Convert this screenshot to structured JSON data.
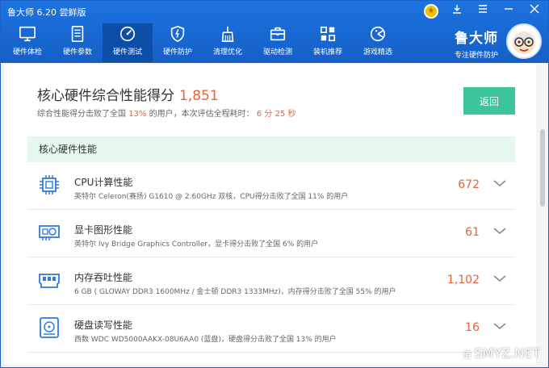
{
  "window": {
    "title": "鲁大师 6.20 尝鲜版"
  },
  "nav": [
    {
      "label": "硬件体检",
      "icon": "monitor-icon"
    },
    {
      "label": "硬件参数",
      "icon": "document-icon"
    },
    {
      "label": "硬件测试",
      "icon": "speedometer-icon"
    },
    {
      "label": "硬件防护",
      "icon": "shield-icon"
    },
    {
      "label": "清理优化",
      "icon": "broom-icon"
    },
    {
      "label": "驱动检测",
      "icon": "toolbox-icon"
    },
    {
      "label": "装机推荐",
      "icon": "apps-icon"
    },
    {
      "label": "游戏精选",
      "icon": "gamepad-icon"
    }
  ],
  "brand": {
    "name": "鲁大师",
    "subtitle": "专注硬件防护"
  },
  "score": {
    "title": "核心硬件综合性能得分",
    "value": "1,851",
    "desc_prefix": "综合性能得分击败了全国",
    "beat_percent": "13%",
    "desc_middle": "的用户，本次评估全程耗时：",
    "duration_min": "6",
    "duration_min_unit": "分",
    "duration_sec": "25",
    "duration_sec_unit": "秒"
  },
  "back_button": "返回",
  "section": {
    "title": "核心硬件性能"
  },
  "rows": [
    {
      "title": "CPU计算性能",
      "detail": "英特尔 Celeron(赛扬) G1610 @ 2.60GHz 双核，CPU得分击败了全国 11% 的用户",
      "score": "672",
      "icon": "cpu-icon"
    },
    {
      "title": "显卡图形性能",
      "detail": "英特尔 Ivy Bridge Graphics Controller，显卡得分击败了全国 6% 的用户",
      "score": "61",
      "icon": "gpu-icon"
    },
    {
      "title": "内存吞吐性能",
      "detail": "6 GB ( GLOWAY DDR3 1600MHz / 金士顿 DDR3 1333MHz)，内存得分击败了全国 55% 的用户",
      "score": "1,102",
      "icon": "memory-icon"
    },
    {
      "title": "硬盘读写性能",
      "detail": "西数 WDC WD5000AAKX-08U6AA0 (蓝盘)，硬盘得分击败了全国 13% 的用户",
      "score": "16",
      "icon": "disk-icon"
    }
  ],
  "watermark": "SMYZ.NET",
  "colors": {
    "header_blue": "#1a67d2",
    "score_orange": "#e8623a",
    "button_green": "#3cc59a",
    "section_green": "#e6f7ee"
  }
}
